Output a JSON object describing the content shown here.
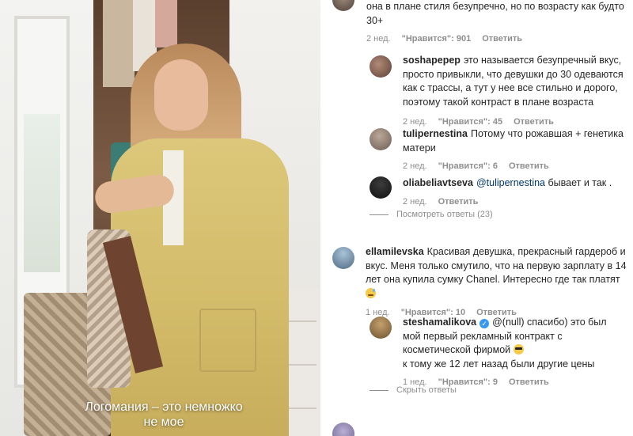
{
  "video": {
    "caption_line1": "Логомания – это немножко",
    "caption_line2": "не мое"
  },
  "comments": {
    "top": {
      "text_line1": "она в плане стиля безупречно, но по возрасту как будто",
      "text_line2": "30+",
      "time": "2 нед.",
      "likes": "\"Нравится\": 901",
      "reply": "Ответить"
    },
    "c1": {
      "user": "soshapерер",
      "text": "это называется безупречный вкус, просто привыкли, что девушки до 30 одеваются как с трассы, а тут у нее все стильно и дорого, поэтому такой контраст в плане возраста",
      "time": "2 нед.",
      "likes": "\"Нравится\": 45",
      "reply": "Ответить"
    },
    "c2": {
      "user": "tulipernestina",
      "text": "Потому что рожавшая + генетика матери",
      "time": "2 нед.",
      "likes": "\"Нравится\": 6",
      "reply": "Ответить"
    },
    "c3": {
      "user": "oliabeliavtseva",
      "mention": "@tulipernestina",
      "text": "бывает и так .",
      "time": "2 нед.",
      "reply": "Ответить"
    },
    "view_replies_1": "Посмотреть ответы (23)",
    "c4": {
      "user": "ellamilevska",
      "text": "Красивая девушка, прекрасный гардероб и вкус. Меня только смутило, что на первую зарплату в 14 лет она купила сумку Chanel. Интересно где так платят",
      "time": "1 нед.",
      "likes": "\"Нравится\": 10",
      "reply": "Ответить"
    },
    "c5": {
      "user": "steshamalikova",
      "text_part1": "@(null) спасибо) это был мой первый рекламный контракт с косметической фирмой",
      "text_part2": "к тому же 12 лет назад были другие цены",
      "time": "1 нед.",
      "likes": "\"Нравится\": 9",
      "reply": "Ответить"
    },
    "hide_replies": "Скрыть ответы"
  }
}
